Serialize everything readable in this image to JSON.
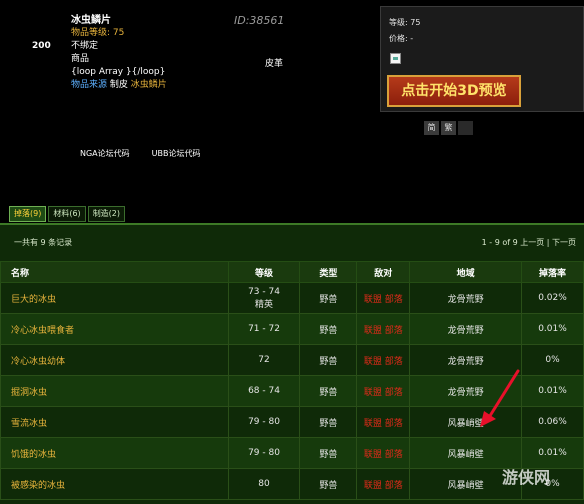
{
  "item": {
    "count": "200",
    "name": "冰虫鳞片",
    "level_label": "物品等级: ",
    "level_value": "75",
    "bind": "不绑定",
    "category": "商品",
    "loop": "{loop Array }{/loop}",
    "source_label": "物品来源",
    "source_method": "制皮",
    "source_item": "冰虫鳞片",
    "id": "ID:38561",
    "subtype": "皮革"
  },
  "preview": {
    "level": "等级: 75",
    "price": "价格: -",
    "button": "点击开始3D预览"
  },
  "lang_buttons": [
    "简",
    "繁",
    ""
  ],
  "code_links": [
    "NGA论坛代码",
    "UBB论坛代码"
  ],
  "tabs": [
    "掉落(9)",
    "材料(6)",
    "制造(2)"
  ],
  "records_text": "一共有 9 条记录",
  "pager_text": "1 - 9 of 9 上一页 | 下一页",
  "columns": [
    "名称",
    "等级",
    "类型",
    "敌对",
    "地域",
    "掉落率"
  ],
  "rows": [
    {
      "name": "巨大的冰虫",
      "level": "73 - 74",
      "level2": "精英",
      "type": "野兽",
      "enemy": "联盟 部落",
      "zone": "龙骨荒野",
      "rate": "0.02%"
    },
    {
      "name": "冷心冰虫喂食者",
      "level": "71 - 72",
      "level2": "",
      "type": "野兽",
      "enemy": "联盟 部落",
      "zone": "龙骨荒野",
      "rate": "0.01%"
    },
    {
      "name": "冷心冰虫幼体",
      "level": "72",
      "level2": "",
      "type": "野兽",
      "enemy": "联盟 部落",
      "zone": "龙骨荒野",
      "rate": "0%"
    },
    {
      "name": "掘洞冰虫",
      "level": "68 - 74",
      "level2": "",
      "type": "野兽",
      "enemy": "联盟 部落",
      "zone": "龙骨荒野",
      "rate": "0.01%"
    },
    {
      "name": "雪流冰虫",
      "level": "79 - 80",
      "level2": "",
      "type": "野兽",
      "enemy": "联盟 部落",
      "zone": "风暴峭壁",
      "rate": "0.06%"
    },
    {
      "name": "饥饿的冰虫",
      "level": "79 - 80",
      "level2": "",
      "type": "野兽",
      "enemy": "联盟 部落",
      "zone": "风暴峭壁",
      "rate": "0.01%"
    },
    {
      "name": "被感染的冰虫",
      "level": "80",
      "level2": "",
      "type": "野兽",
      "enemy": "联盟 部落",
      "zone": "风暴峭壁",
      "rate": "0%"
    }
  ],
  "watermark": "游侠网",
  "colors": {
    "gold": "#e8b43c",
    "enemy": "#e02a1a",
    "panel": "#0f2a08",
    "accent_button": "#b53a1a"
  }
}
